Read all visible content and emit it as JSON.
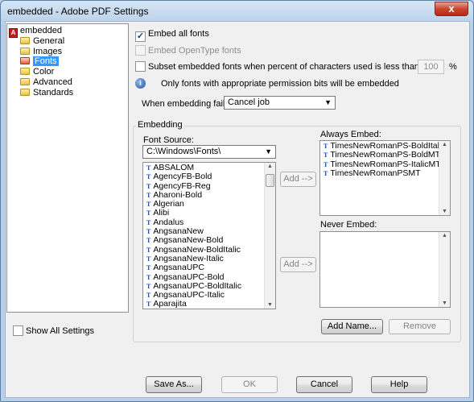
{
  "window": {
    "title": "embedded - Adobe PDF Settings",
    "close_label": "x"
  },
  "tree": {
    "root": "embedded",
    "items": [
      {
        "label": "General",
        "selected": false
      },
      {
        "label": "Images",
        "selected": false
      },
      {
        "label": "Fonts",
        "selected": true
      },
      {
        "label": "Color",
        "selected": false
      },
      {
        "label": "Advanced",
        "selected": false
      },
      {
        "label": "Standards",
        "selected": false
      }
    ]
  },
  "show_all_settings": {
    "label": "Show All Settings",
    "checked": false
  },
  "options": {
    "embed_all": {
      "label": "Embed all fonts",
      "checked": true
    },
    "embed_opentype": {
      "label": "Embed OpenType fonts",
      "checked": false,
      "enabled": false
    },
    "subset": {
      "label": "Subset embedded fonts when percent of characters used is less than:",
      "checked": false
    },
    "subset_value": "100",
    "subset_unit": "%",
    "info_text": "Only fonts with appropriate permission bits will be embedded",
    "fail_label": "When embedding fails:",
    "fail_value": "Cancel job"
  },
  "embedding": {
    "group_label": "Embedding",
    "font_source_label": "Font Source:",
    "font_source_value": "C:\\Windows\\Fonts\\",
    "fonts": [
      "ABSALOM",
      "AgencyFB-Bold",
      "AgencyFB-Reg",
      "Aharoni-Bold",
      "Algerian",
      "Alibi",
      "Andalus",
      "AngsanaNew",
      "AngsanaNew-Bold",
      "AngsanaNew-BoldItalic",
      "AngsanaNew-Italic",
      "AngsanaUPC",
      "AngsanaUPC-Bold",
      "AngsanaUPC-BoldItalic",
      "AngsanaUPC-Italic",
      "Aparajita"
    ],
    "always_label": "Always Embed:",
    "always_fonts": [
      "TimesNewRomanPS-BoldItalic",
      "TimesNewRomanPS-BoldMT",
      "TimesNewRomanPS-ItalicMT",
      "TimesNewRomanPSMT"
    ],
    "never_label": "Never Embed:",
    "never_fonts": [],
    "add_label": "Add -->",
    "add_name_label": "Add Name...",
    "remove_label": "Remove"
  },
  "footer": {
    "save_as": "Save As...",
    "ok": "OK",
    "cancel": "Cancel",
    "help": "Help"
  }
}
